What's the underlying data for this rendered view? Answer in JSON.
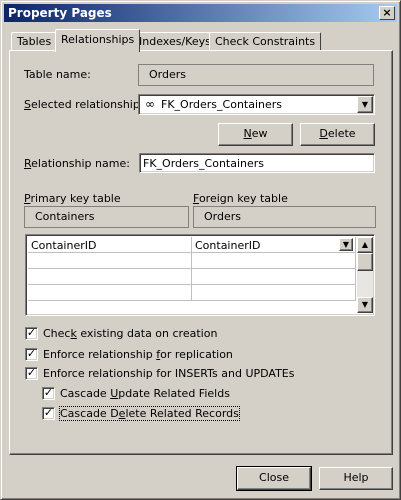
{
  "window": {
    "title": "Property Pages",
    "close_glyph": "×"
  },
  "tabs": [
    {
      "label": "Tables",
      "active": false
    },
    {
      "label": "Relationships",
      "active": true
    },
    {
      "label": "Indexes/Keys",
      "active": false
    },
    {
      "label": "Check Constraints",
      "active": false
    }
  ],
  "table_name": {
    "label": "Table name:",
    "value": "Orders"
  },
  "selected_relationship": {
    "label_prefix": "",
    "label_u": "S",
    "label_rest": "elected relationship:",
    "icon_glyph": "∞",
    "value": "FK_Orders_Containers"
  },
  "buttons": {
    "new_u": "N",
    "new_rest": "ew",
    "delete_u": "D",
    "delete_rest": "elete",
    "close": "Close",
    "help": "Help"
  },
  "relationship_name": {
    "label_u": "R",
    "label_rest": "elationship name:",
    "value": "FK_Orders_Containers"
  },
  "primary_key_table": {
    "label_u": "P",
    "label_rest": "rimary key table",
    "value": "Containers"
  },
  "foreign_key_table": {
    "label_u": "F",
    "label_rest": "oreign key table",
    "value": "Orders"
  },
  "key_grid": {
    "rows": [
      {
        "primary": "ContainerID",
        "foreign": "ContainerID"
      },
      {
        "primary": "",
        "foreign": ""
      },
      {
        "primary": "",
        "foreign": ""
      },
      {
        "primary": "",
        "foreign": ""
      }
    ]
  },
  "options": [
    {
      "pre": "Chec",
      "u": "k",
      "post": " existing data on creation",
      "checked": true
    },
    {
      "pre": "Enforce relationship ",
      "u": "f",
      "post": "or replication",
      "checked": true
    },
    {
      "pre": "Enforce relationship for INSERTs and UPDATEs",
      "u": "",
      "post": "",
      "checked": true
    },
    {
      "pre": "Cascade ",
      "u": "U",
      "post": "pdate Related Fields",
      "checked": true
    },
    {
      "pre": "Cascade D",
      "u": "e",
      "post": "lete Related Records",
      "checked": true
    }
  ]
}
